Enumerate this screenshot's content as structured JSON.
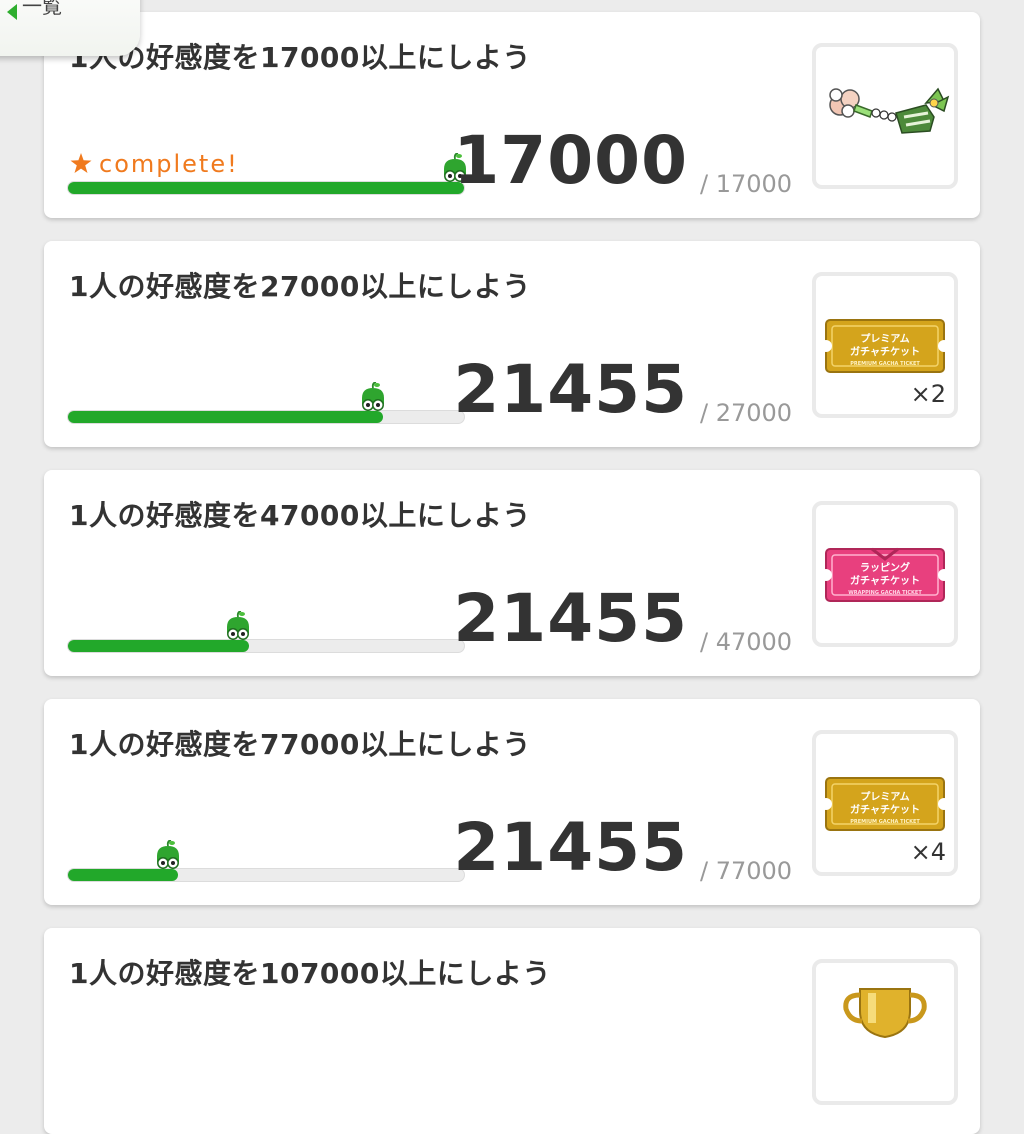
{
  "header": {
    "back_label": "一覧"
  },
  "missions": [
    {
      "title": "1人の好感度を17000以上にしよう",
      "current": "17000",
      "target": "/ 17000",
      "progress": 1.0,
      "complete": true,
      "complete_label": "complete!",
      "reward": {
        "icon": "flower-staff",
        "qty": ""
      }
    },
    {
      "title": "1人の好感度を27000以上にしよう",
      "current": "21455",
      "target": "/ 27000",
      "progress": 0.795,
      "complete": false,
      "reward": {
        "icon": "premium-gacha-ticket",
        "qty": "×2",
        "ticket_line1": "プレミアム",
        "ticket_line2": "ガチャチケット",
        "ticket_line3": "PREMIUM GACHA TICKET"
      }
    },
    {
      "title": "1人の好感度を47000以上にしよう",
      "current": "21455",
      "target": "/ 47000",
      "progress": 0.456,
      "complete": false,
      "reward": {
        "icon": "wrapping-gacha-ticket",
        "qty": "",
        "ticket_line1": "ラッピング",
        "ticket_line2": "ガチャチケット",
        "ticket_line3": "WRAPPING GACHA TICKET"
      }
    },
    {
      "title": "1人の好感度を77000以上にしよう",
      "current": "21455",
      "target": "/ 77000",
      "progress": 0.279,
      "complete": false,
      "reward": {
        "icon": "premium-gacha-ticket",
        "qty": "×4",
        "ticket_line1": "プレミアム",
        "ticket_line2": "ガチャチケット",
        "ticket_line3": "PREMIUM GACHA TICKET"
      }
    },
    {
      "title": "1人の好感度を107000以上にしよう",
      "reward": {
        "icon": "trophy",
        "qty": ""
      }
    }
  ],
  "colors": {
    "progress_fill": "#22a82a",
    "complete_orange": "#f07a1e",
    "gold_ticket": "#d4a41c",
    "pink_ticket": "#e8407e"
  }
}
